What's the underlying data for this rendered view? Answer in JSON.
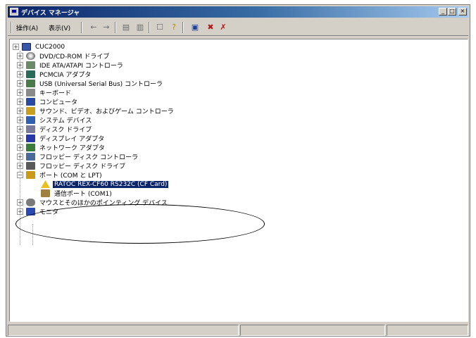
{
  "window": {
    "title": "デバイス マネージャ",
    "controls": {
      "minimize": "_",
      "maximize": "□",
      "close": "×"
    }
  },
  "menu": {
    "items": [
      "操作(A)",
      "表示(V)"
    ]
  },
  "toolbar": {
    "buttons": [
      {
        "name": "back-arrow-icon",
        "glyph": "←"
      },
      {
        "name": "forward-arrow-icon",
        "glyph": "→"
      },
      {
        "name": "view-grid-icon",
        "glyph": "▤"
      },
      {
        "name": "view-list-icon",
        "glyph": "▥"
      },
      {
        "name": "properties-icon",
        "glyph": "☐"
      },
      {
        "name": "help-icon",
        "glyph": "?"
      },
      {
        "name": "scan-hardware-icon",
        "glyph": "▣"
      },
      {
        "name": "disable-device-icon",
        "glyph": "✖"
      },
      {
        "name": "uninstall-device-icon",
        "glyph": "✗"
      }
    ]
  },
  "tree": {
    "root": "CUC2000",
    "items": [
      {
        "label": "DVD/CD-ROM ドライブ",
        "icon": "disc"
      },
      {
        "label": "IDE ATA/ATAPI コントローラ",
        "icon": "ide"
      },
      {
        "label": "PCMCIA アダプタ",
        "icon": "pcmcia"
      },
      {
        "label": "USB (Universal Serial Bus) コントローラ",
        "icon": "usb"
      },
      {
        "label": "キーボード",
        "icon": "keyboard"
      },
      {
        "label": "コンピュータ",
        "icon": "cpu"
      },
      {
        "label": "サウンド、ビデオ、およびゲーム コントローラ",
        "icon": "sound"
      },
      {
        "label": "システム デバイス",
        "icon": "system"
      },
      {
        "label": "ディスク ドライブ",
        "icon": "disk"
      },
      {
        "label": "ディスプレイ アダプタ",
        "icon": "display"
      },
      {
        "label": "ネットワーク アダプタ",
        "icon": "network"
      },
      {
        "label": "フロッピー ディスク コントローラ",
        "icon": "floppyctl"
      },
      {
        "label": "フロッピー ディスク ドライブ",
        "icon": "floppy"
      },
      {
        "label": "ポート (COM と LPT)",
        "icon": "port"
      }
    ],
    "port_children": [
      {
        "label": "RATOC REX-CF60 RS232C (CF Card)",
        "icon": "warn",
        "selected": true
      },
      {
        "label": "通信ポート (COM1)",
        "icon": "com",
        "selected": false
      }
    ],
    "after_items": [
      {
        "label": "マウスとそのほかのポインティング デバイス",
        "icon": "mouse"
      },
      {
        "label": "モニタ",
        "icon": "monitor"
      }
    ],
    "expand_glyph": "+",
    "collapse_glyph": "−"
  },
  "colors": {
    "titlebar_start": "#0a246a",
    "selection": "#0a246a",
    "window_face": "#d4d0c8"
  }
}
